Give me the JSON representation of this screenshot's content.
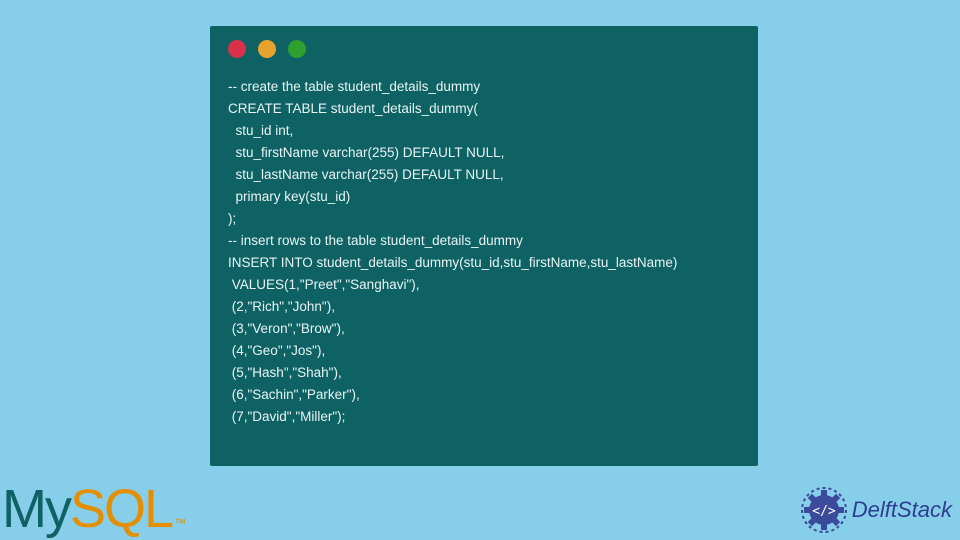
{
  "code": {
    "lines": [
      "-- create the table student_details_dummy",
      "CREATE TABLE student_details_dummy(",
      "  stu_id int,",
      "  stu_firstName varchar(255) DEFAULT NULL,",
      "  stu_lastName varchar(255) DEFAULT NULL,",
      "  primary key(stu_id)",
      ");",
      "-- insert rows to the table student_details_dummy",
      "INSERT INTO student_details_dummy(stu_id,stu_firstName,stu_lastName) ",
      " VALUES(1,\"Preet\",\"Sanghavi\"),",
      " (2,\"Rich\",\"John\"),",
      " (3,\"Veron\",\"Brow\"),",
      " (4,\"Geo\",\"Jos\"),",
      " (5,\"Hash\",\"Shah\"),",
      " (6,\"Sachin\",\"Parker\"),",
      " (7,\"David\",\"Miller\");"
    ]
  },
  "logos": {
    "mysql_my": "My",
    "mysql_sql": "SQL",
    "mysql_tm": "™",
    "delftstack": "DelftStack"
  }
}
